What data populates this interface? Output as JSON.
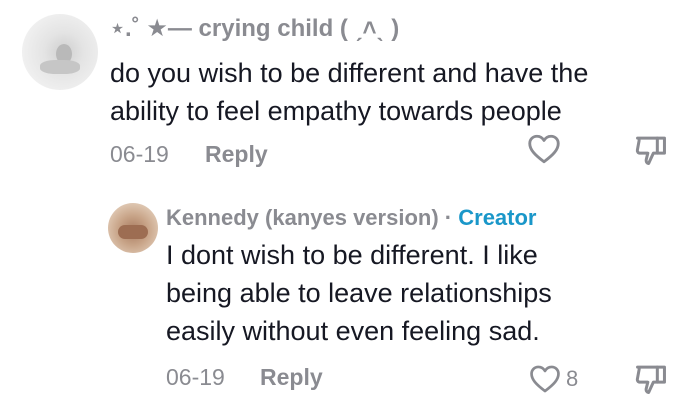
{
  "comment": {
    "username": "⋆.˚ ★— crying child ( ˏ˄ˎ )",
    "text_line1": "do you wish to be different and have the",
    "text_line2": "ability to feel empathy towards people",
    "date": "06-19",
    "reply_label": "Reply",
    "icons": {
      "like": "heart-outline-icon",
      "dislike": "thumb-down-outline-icon"
    }
  },
  "reply": {
    "username": "Kennedy (kanyes version)",
    "separator": "·",
    "creator_badge": "Creator",
    "text_line1": "I dont wish to be different. I like",
    "text_line2": "being able to leave relationships",
    "text_line3": "easily without even feeling sad.",
    "date": "06-19",
    "reply_label": "Reply",
    "like_count": "8",
    "icons": {
      "like": "heart-outline-icon",
      "dislike": "thumb-down-outline-icon"
    }
  },
  "colors": {
    "text": "#161823",
    "muted": "#8a8b91",
    "creator": "#1a97c9",
    "background": "#ffffff"
  }
}
